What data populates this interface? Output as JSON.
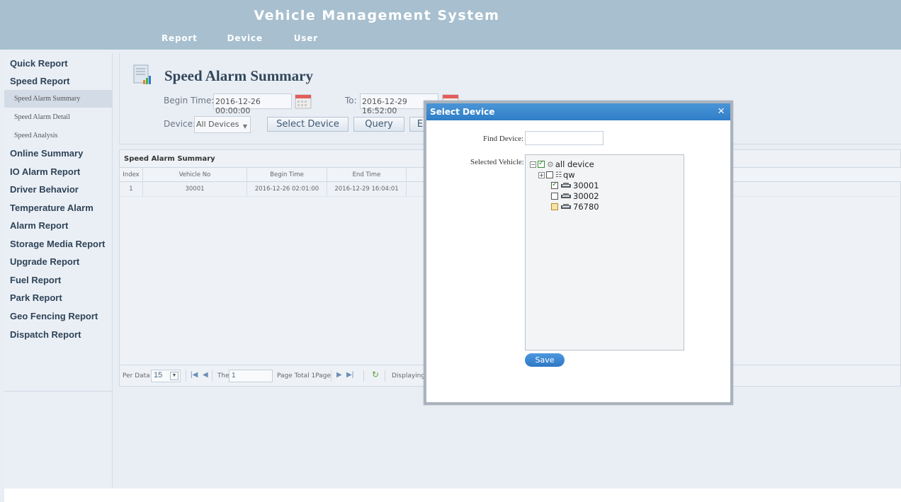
{
  "app": {
    "title": "Vehicle Management System"
  },
  "topnav": [
    "Report",
    "Device",
    "User"
  ],
  "sidebar": {
    "items": [
      "Quick Report",
      "Speed Report",
      "Online Summary",
      "IO Alarm Report",
      "Driver Behavior",
      "Temperature Alarm",
      "Alarm Report",
      "Storage Media Report",
      "Upgrade Report",
      "Fuel Report",
      "Park Report",
      "Geo Fencing Report",
      "Dispatch Report"
    ],
    "subitems": [
      "Speed Alarm Summary",
      "Speed Alarm Detail",
      "Speed Analysis"
    ],
    "active_subitem": "Speed Alarm Summary"
  },
  "report": {
    "title": "Speed Alarm Summary",
    "begin_label": "Begin Time:",
    "begin_value": "2016-12-26 00:00:00",
    "to_label": "To:",
    "to_value": "2016-12-29 16:52:00",
    "device_label": "Device:",
    "device_value": "All Devices",
    "select_device_btn": "Select Device",
    "query_btn": "Query",
    "third_btn": "E"
  },
  "grid": {
    "title": "Speed Alarm Summary",
    "columns": [
      "Index",
      "Vehicle No",
      "Begin Time",
      "End Time"
    ],
    "rows": [
      [
        "1",
        "30001",
        "2016-12-26 02:01:00",
        "2016-12-29 16:04:01"
      ]
    ]
  },
  "pager": {
    "per_data_label": "Per Data",
    "per_data_value": "15",
    "the_label": "The",
    "page_value": "1",
    "page_total": "Page  Total 1Page",
    "displaying": "Displaying"
  },
  "modal": {
    "title": "Select Device",
    "close": "×",
    "find_label": "Find Device:",
    "selected_label": "Selected Vehicle:",
    "save": "Save",
    "tree": {
      "root": "all device",
      "group": "qw",
      "vehicles": [
        "30001",
        "30002",
        "76780"
      ]
    }
  },
  "colors": {
    "header_bg": "#a7bfcf",
    "modal_header": "#3a86cf",
    "page_bg": "#e9eef5"
  }
}
